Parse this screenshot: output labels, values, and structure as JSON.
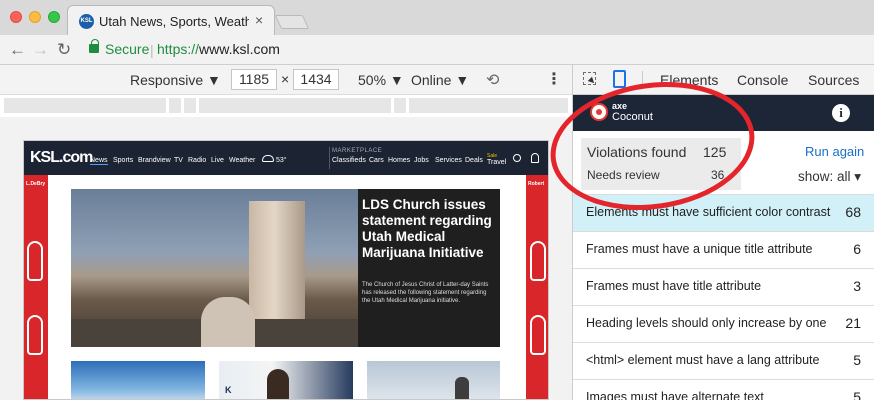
{
  "browser": {
    "tab_title": "Utah News, Sports, Weather and",
    "tab_favicon_text": "KSL",
    "secure_label": "Secure",
    "url_scheme": "https://",
    "url_host": "www.ksl.com"
  },
  "device_toolbar": {
    "mode": "Responsive ▼",
    "width": "1185",
    "times": "×",
    "height": "1434",
    "zoom": "50% ▼",
    "network": "Online ▼"
  },
  "site": {
    "logo": "KSL.com",
    "nav_items": [
      "News",
      "Sports",
      "Brandview",
      "TV",
      "Radio",
      "Live",
      "Weather"
    ],
    "temp": "53°",
    "marketplace_label": "MARKETPLACE",
    "market_items": [
      "Classifieds",
      "Cars",
      "Homes",
      "Jobs",
      "Services",
      "Deals"
    ],
    "travel_small": "Sale",
    "travel": "Travel",
    "ad_left_brand": "L.DeBry",
    "ad_right_brand": "Robert",
    "hero_title": "LDS Church issues statement regarding Utah Medical Marijuana Initiative",
    "hero_desc": "The Church of Jesus Christ of Latter-day Saints has released the following statement regarding the Utah Medical Marijuana initiative.",
    "thumb2_label": "K"
  },
  "devtools": {
    "tabs": [
      "Elements",
      "Console",
      "Sources"
    ],
    "coconut": {
      "axe_label": "axe",
      "name": "Coconut",
      "info_glyph": "i",
      "violations_label": "Violations found",
      "violations_count": "125",
      "review_label": "Needs review",
      "review_count": "36",
      "run_again": "Run again",
      "show_filter": "show: all ▾",
      "violations": [
        {
          "label": "Elements must have sufficient color contrast",
          "count": "68"
        },
        {
          "label": "Frames must have a unique title attribute",
          "count": "6"
        },
        {
          "label": "Frames must have title attribute",
          "count": "3"
        },
        {
          "label": "Heading levels should only increase by one",
          "count": "21"
        },
        {
          "label": "<html> element must have a lang attribute",
          "count": "5"
        },
        {
          "label": "Images must have alternate text",
          "count": "5"
        }
      ]
    }
  },
  "colors": {
    "annotation_ring": "#e4252b",
    "secure_green": "#1e8e3e",
    "link_blue": "#1a6fc9",
    "selected_row": "#d1f0f7",
    "coconut_header": "#1d2636"
  }
}
